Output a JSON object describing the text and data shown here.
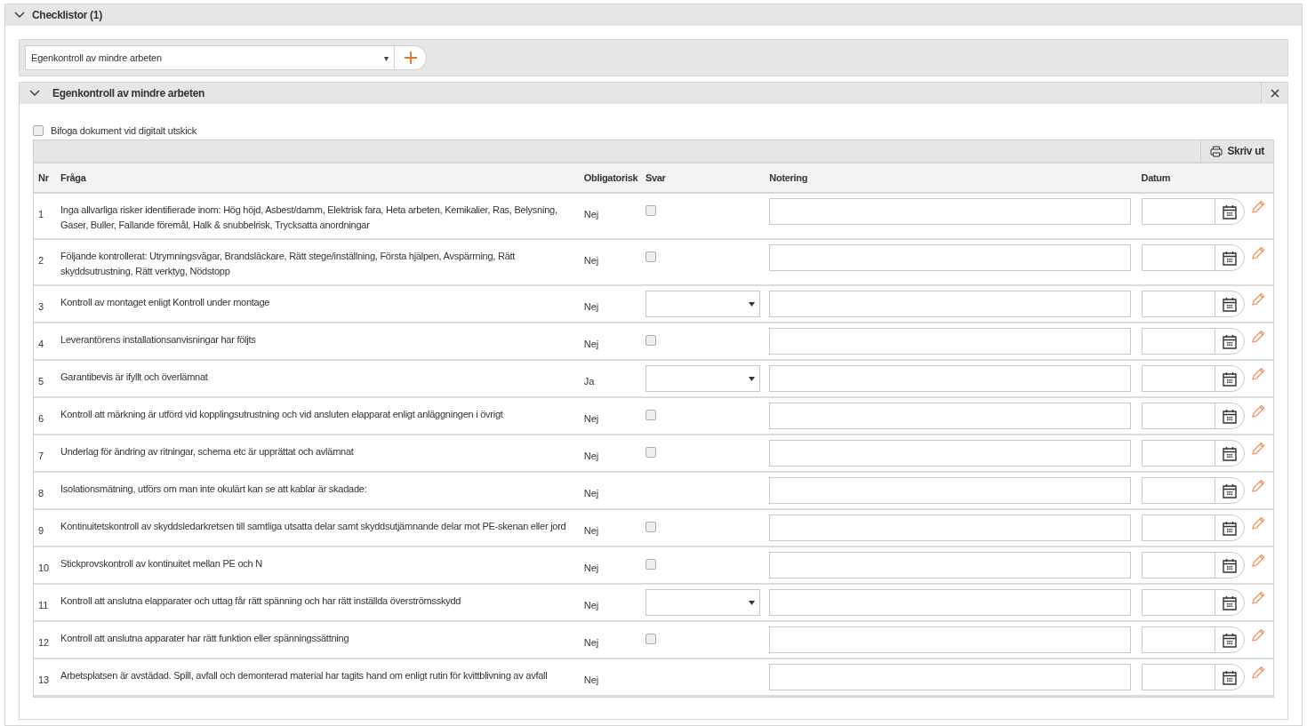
{
  "section": {
    "title": "Checklistor (1)",
    "expanded": true
  },
  "template_select": {
    "value": "Egenkontroll av mindre arbeten",
    "arrow": "▾"
  },
  "checklist": {
    "title": "Egenkontroll av mindre arbeten",
    "expanded": true,
    "attach_option": {
      "label": "Bifoga dokument vid digitalt utskick",
      "checked": false
    },
    "print_button": "Skriv ut",
    "columns": [
      "Nr",
      "Fråga",
      "Obligatorisk",
      "Svar",
      "Notering",
      "Datum"
    ],
    "rows": [
      {
        "nr": "1",
        "question": "Inga allvarliga risker identifierade inom: Hög höjd, Asbest/damm, Elektrisk fara, Heta arbeten, Kemikalier, Ras, Belysning, Gaser, Buller, Fallande föremål, Halk & snubbelrisk, Trycksatta anordningar",
        "required": "Nej",
        "kind": "checkbox",
        "checked": false
      },
      {
        "nr": "2",
        "question": "Följande kontrollerat: Utrymningsvägar, Brandsläckare, Rätt stege/inställning, Första hjälpen, Avspärrning, Rätt skyddsutrustning, Rätt verktyg, Nödstopp",
        "required": "Nej",
        "kind": "checkbox",
        "checked": false
      },
      {
        "nr": "3",
        "question": "Kontroll av montaget enligt Kontroll under montage",
        "required": "Nej",
        "kind": "select"
      },
      {
        "nr": "4",
        "question": "Leverantörens installationsanvisningar har följts",
        "required": "Nej",
        "kind": "checkbox",
        "checked": false
      },
      {
        "nr": "5",
        "question": "Garantibevis är ifyllt och överlämnat",
        "required": "Ja",
        "kind": "select"
      },
      {
        "nr": "6",
        "question": "Kontroll att märkning är utförd vid kopplingsutrustning och vid ansluten elapparat enligt anläggningen i övrigt",
        "required": "Nej",
        "kind": "checkbox",
        "checked": false
      },
      {
        "nr": "7",
        "question": "Underlag för ändring av ritningar, schema etc är upprättat och avlämnat",
        "required": "Nej",
        "kind": "checkbox",
        "checked": false
      },
      {
        "nr": "8",
        "question": "Isolationsmätning, utförs om man inte okulärt kan se att kablar är skadade:",
        "required": "Nej",
        "kind": "none"
      },
      {
        "nr": "9",
        "question": "Kontinuitetskontroll av skyddsledarkretsen till samtliga utsatta delar samt skyddsutjämnande delar mot PE-skenan eller jord",
        "required": "Nej",
        "kind": "checkbox",
        "checked": false
      },
      {
        "nr": "10",
        "question": "Stickprovskontroll av kontinuitet mellan PE och N",
        "required": "Nej",
        "kind": "checkbox",
        "checked": false
      },
      {
        "nr": "11",
        "question": "Kontroll att anslutna elapparater och uttag får rätt spänning och har rätt inställda överströmsskydd",
        "required": "Nej",
        "kind": "select"
      },
      {
        "nr": "12",
        "question": "Kontroll att anslutna apparater har rätt funktion eller spänningssättning",
        "required": "Nej",
        "kind": "checkbox",
        "checked": false
      },
      {
        "nr": "13",
        "question": "Arbetsplatsen är avstädad. Spill, avfall och demonterad material har tagits hand om enligt rutin för kvittblivning av avfall",
        "required": "Nej",
        "kind": "none"
      }
    ]
  }
}
